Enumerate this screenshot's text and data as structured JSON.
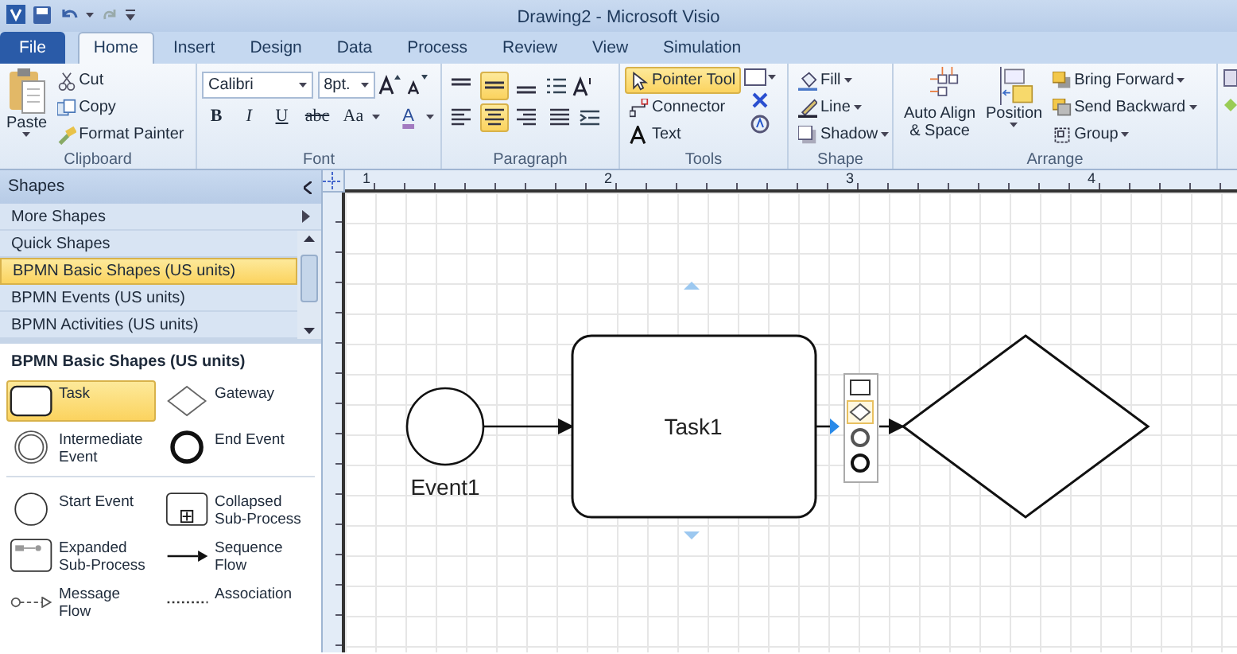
{
  "window": {
    "title": "Drawing2  -  Microsoft Visio"
  },
  "tabs": [
    {
      "label": "File",
      "kind": "file",
      "selected": false
    },
    {
      "label": "Home",
      "kind": "tab",
      "selected": true
    },
    {
      "label": "Insert",
      "kind": "tab",
      "selected": false
    },
    {
      "label": "Design",
      "kind": "tab",
      "selected": false
    },
    {
      "label": "Data",
      "kind": "tab",
      "selected": false
    },
    {
      "label": "Process",
      "kind": "tab",
      "selected": false
    },
    {
      "label": "Review",
      "kind": "tab",
      "selected": false
    },
    {
      "label": "View",
      "kind": "tab",
      "selected": false
    },
    {
      "label": "Simulation",
      "kind": "tab",
      "selected": false
    }
  ],
  "ribbon": {
    "clipboard": {
      "label": "Clipboard",
      "paste": "Paste",
      "commands": [
        "Cut",
        "Copy",
        "Format Painter"
      ]
    },
    "font": {
      "label": "Font",
      "font_name": "Calibri",
      "font_size": "8pt.",
      "format_buttons": [
        "B",
        "I",
        "U",
        "abc",
        "Aa"
      ],
      "color_button": "A"
    },
    "paragraph": {
      "label": "Paragraph",
      "vertical_align": [
        {
          "selected": false
        },
        {
          "selected": true
        },
        {
          "selected": false
        }
      ],
      "horizontal_align": [
        {
          "selected": false
        },
        {
          "selected": true
        },
        {
          "selected": false
        },
        {
          "selected": false
        }
      ]
    },
    "tools": {
      "label": "Tools",
      "items": [
        {
          "label": "Pointer Tool",
          "kind": "pointer",
          "selected": true
        },
        {
          "label": "Connector",
          "kind": "connector",
          "selected": false
        },
        {
          "label": "Text",
          "kind": "text",
          "selected": false
        }
      ]
    },
    "shape": {
      "label": "Shape",
      "items": [
        {
          "label": "Fill",
          "kind": "fill"
        },
        {
          "label": "Line",
          "kind": "line"
        },
        {
          "label": "Shadow",
          "kind": "shadow"
        }
      ]
    },
    "arrange": {
      "label": "Arrange",
      "large": [
        {
          "label": "Auto Align & Space",
          "kind": "align"
        },
        {
          "label": "Position",
          "kind": "position"
        }
      ],
      "small": [
        {
          "label": "Bring Forward",
          "kind": "forward"
        },
        {
          "label": "Send Backward",
          "kind": "backward"
        },
        {
          "label": "Group",
          "kind": "group"
        }
      ]
    }
  },
  "shapes_panel": {
    "title": "Shapes",
    "sections": [
      {
        "label": "More Shapes",
        "kind": "menu",
        "selected": false
      },
      {
        "label": "Quick Shapes",
        "kind": "stencil",
        "selected": false
      },
      {
        "label": "BPMN Basic Shapes (US units)",
        "kind": "stencil",
        "selected": true
      },
      {
        "label": "BPMN Events (US units)",
        "kind": "stencil",
        "selected": false
      },
      {
        "label": "BPMN Activities (US units)",
        "kind": "stencil",
        "selected": false
      }
    ],
    "stencil_title": "BPMN Basic Shapes (US units)",
    "stencil_groups": [
      [
        {
          "label": "Task",
          "kind": "task",
          "selected": true
        },
        {
          "label": "Gateway",
          "kind": "gateway",
          "selected": false
        },
        {
          "label": "Intermediate Event",
          "kind": "intermediate",
          "selected": false
        },
        {
          "label": "End Event",
          "kind": "end",
          "selected": false
        }
      ],
      [
        {
          "label": "Start Event",
          "kind": "start",
          "selected": false
        },
        {
          "label": "Collapsed Sub-Process",
          "kind": "collapsed",
          "selected": false
        },
        {
          "label": "Expanded Sub-Process",
          "kind": "expanded",
          "selected": false
        },
        {
          "label": "Sequence Flow",
          "kind": "sequence",
          "selected": false
        },
        {
          "label": "Message Flow",
          "kind": "message",
          "selected": false
        },
        {
          "label": "Association",
          "kind": "association",
          "selected": false
        }
      ]
    ]
  },
  "canvas": {
    "ruler_labels": [
      "1",
      "2",
      "3",
      "4"
    ],
    "event_label": "Event1",
    "task_label": "Task1"
  }
}
